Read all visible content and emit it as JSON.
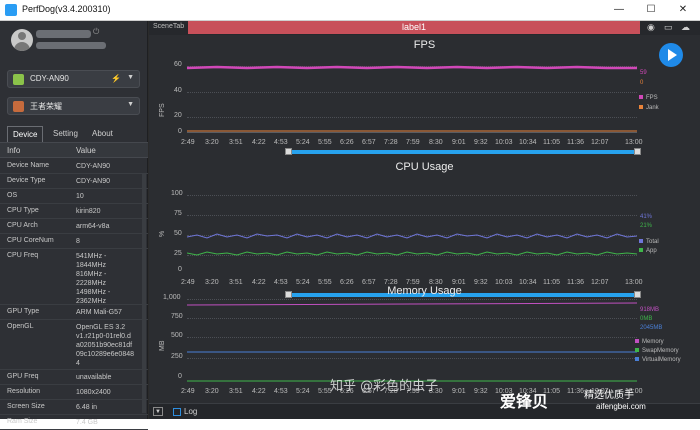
{
  "window": {
    "title": "PerfDog(v3.4.200310)",
    "min": "—",
    "max": "☐",
    "close": "✕"
  },
  "sidebar": {
    "device_dropdown": "CDY-AN90",
    "app_dropdown": "王者荣耀",
    "tabs": [
      "Device",
      "Setting",
      "About"
    ],
    "table_header": {
      "key": "Info",
      "value": "Value"
    },
    "rows": [
      {
        "k": "Device Name",
        "v": "CDY-AN90"
      },
      {
        "k": "Device Type",
        "v": "CDY-AN90"
      },
      {
        "k": "OS",
        "v": "10"
      },
      {
        "k": "CPU Type",
        "v": "kirin820"
      },
      {
        "k": "CPU Arch",
        "v": "arm64-v8a"
      },
      {
        "k": "CPU CoreNum",
        "v": "8"
      },
      {
        "k": "CPU Freq",
        "v": "541MHz -\n1844MHz\n816MHz -\n2228MHz\n1498MHz -\n2362MHz"
      },
      {
        "k": "GPU Type",
        "v": "ARM Mali-G57"
      },
      {
        "k": "OpenGL",
        "v": "OpenGL ES 3.2\nv1.r21p0-01rel0.d\na02051b90ec81df\n09c10289e6e0848\n4"
      },
      {
        "k": "GPU Freq",
        "v": "unavailable"
      },
      {
        "k": "Resolution",
        "v": "1080x2400"
      },
      {
        "k": "Screen Size",
        "v": "6.48 in"
      },
      {
        "k": "Ram Size",
        "v": "7.4 GB"
      }
    ]
  },
  "scene": {
    "tab_label": "SceneTab",
    "label": "label1"
  },
  "time_ticks": [
    "2:49",
    "3:20",
    "3:51",
    "4:22",
    "4:53",
    "5:24",
    "5:55",
    "6:26",
    "6:57",
    "7:28",
    "7:59",
    "8:30",
    "9:01",
    "9:32",
    "10:03",
    "10:34",
    "11:05",
    "11:36",
    "12:07",
    "13:00"
  ],
  "fps": {
    "title": "FPS",
    "ylabel": "FPS",
    "yticks": [
      "60",
      "40",
      "20",
      "0"
    ],
    "values": [
      "59",
      "0"
    ],
    "legend": [
      "FPS",
      "Jank"
    ],
    "colors": {
      "fps": "#d148b8",
      "jank": "#e8833a"
    }
  },
  "cpu": {
    "title": "CPU Usage",
    "ylabel": "%",
    "yticks": [
      "100",
      "75",
      "50",
      "25",
      "0"
    ],
    "values": [
      "41%",
      "21%"
    ],
    "legend": [
      "Total",
      "App"
    ],
    "colors": {
      "total": "#6f76d9",
      "app": "#3fb64a"
    }
  },
  "memory": {
    "title": "Memory Usage",
    "ylabel": "MB",
    "yticks": [
      "1,000",
      "750",
      "500",
      "250",
      "0"
    ],
    "values": [
      "918MB",
      "0MB",
      "2045MB"
    ],
    "legend": [
      "Memory",
      "SwapMemory",
      "VirtualMemory"
    ],
    "colors": {
      "memory": "#c050c0",
      "swap": "#3fb64a",
      "virtual": "#4a7fd6"
    }
  },
  "bottom": {
    "log_label": "Log"
  },
  "watermark": {
    "zhihu": "知乎 @彩色的虫子",
    "brand": "爱锋贝",
    "sub": "精选优质手",
    "url": "aifengbei.com"
  }
}
